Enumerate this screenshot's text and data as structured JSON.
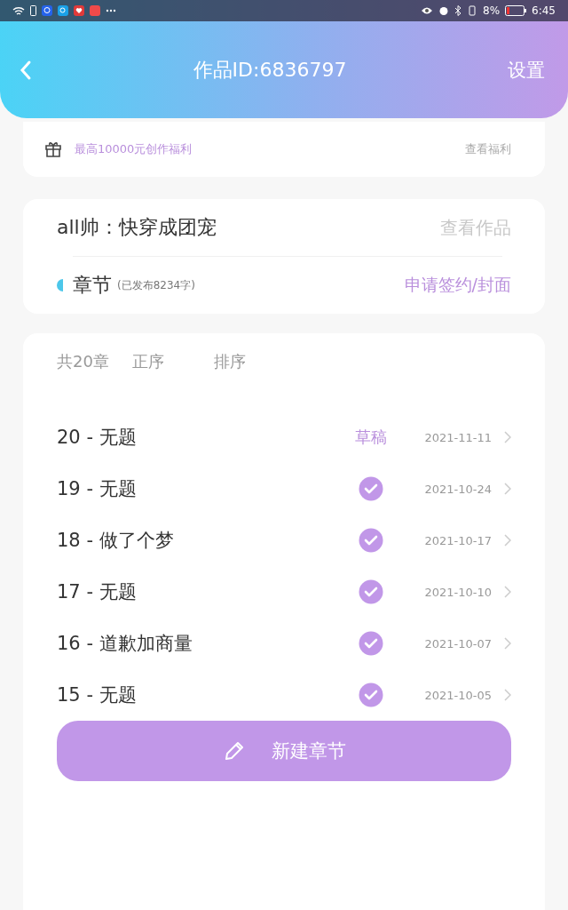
{
  "status_bar": {
    "battery": "8%",
    "time": "6:45"
  },
  "header": {
    "title": "作品ID:6836797",
    "settings": "设置"
  },
  "benefit": {
    "text": "最高10000元创作福利",
    "link": "查看福利"
  },
  "work": {
    "title": "all帅：快穿成团宠",
    "view": "查看作品",
    "section": "章节",
    "published_note": "(已发布8234字)",
    "apply": "申请签约/封面"
  },
  "chapters": {
    "count": "共20章",
    "order": "正序",
    "sort": "排序",
    "items": [
      {
        "title": "20 - 无题",
        "kind": "draft",
        "status_label": "草稿",
        "date": "2021-11-11"
      },
      {
        "title": "19 - 无题",
        "kind": "published",
        "date": "2021-10-24"
      },
      {
        "title": "18 - 做了个梦",
        "kind": "published",
        "date": "2021-10-17"
      },
      {
        "title": "17 - 无题",
        "kind": "published",
        "date": "2021-10-10"
      },
      {
        "title": "16 - 道歉加商量",
        "kind": "published",
        "date": "2021-10-07"
      },
      {
        "title": "15 - 无题",
        "kind": "published",
        "date": "2021-10-05"
      }
    ]
  },
  "new_chapter": "新建章节"
}
